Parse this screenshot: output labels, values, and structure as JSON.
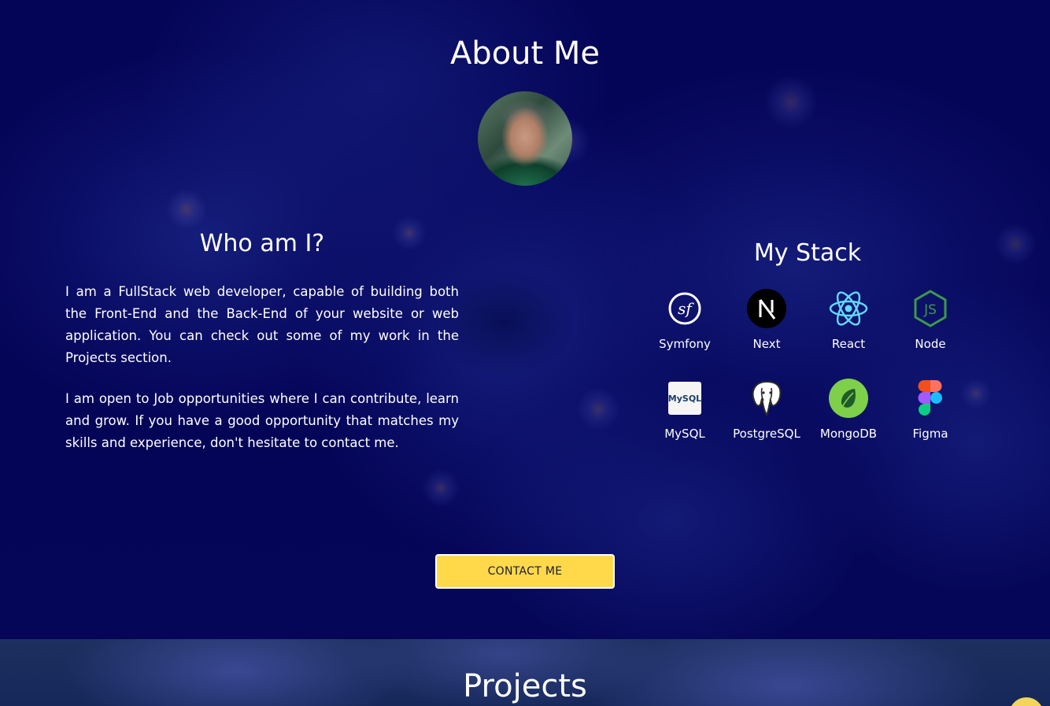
{
  "about": {
    "title": "About Me"
  },
  "who": {
    "heading": "Who am I?",
    "paragraphs": [
      "I am a FullStack web developer, capable of building both the Front-End and the Back-End of your website or web application. You can check out some of my work in the Projects section.",
      "I am open to Job opportunities where I can contribute, learn and grow. If you have a good opportunity that matches my skills and experience, don't hesitate to contact me."
    ]
  },
  "stack": {
    "heading": "My Stack",
    "items": [
      {
        "label": "Symfony",
        "icon": "symfony-icon"
      },
      {
        "label": "Next",
        "icon": "next-icon"
      },
      {
        "label": "React",
        "icon": "react-icon"
      },
      {
        "label": "Node",
        "icon": "node-icon"
      },
      {
        "label": "MySQL",
        "icon": "mysql-icon"
      },
      {
        "label": "PostgreSQL",
        "icon": "postgresql-icon"
      },
      {
        "label": "MongoDB",
        "icon": "mongodb-icon"
      },
      {
        "label": "Figma",
        "icon": "figma-icon"
      }
    ]
  },
  "cta": {
    "contact_label": "CONTACT ME"
  },
  "projects": {
    "title": "Projects"
  },
  "colors": {
    "background": "#06065c",
    "button": "#ffd94a",
    "text": "#ffffff"
  }
}
